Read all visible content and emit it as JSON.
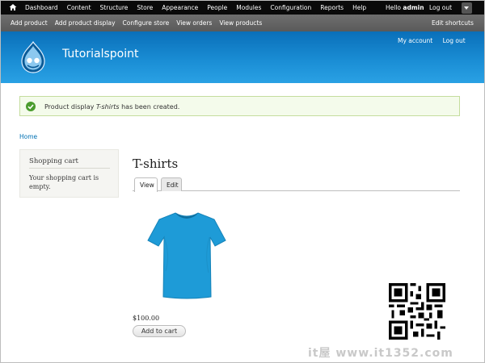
{
  "toolbar": {
    "menu": [
      "Dashboard",
      "Content",
      "Structure",
      "Store",
      "Appearance",
      "People",
      "Modules",
      "Configuration",
      "Reports",
      "Help"
    ],
    "hello_prefix": "Hello ",
    "username": "admin",
    "logout": "Log out",
    "home_icon": "home-icon",
    "toggle_icon": "chevron-down-icon"
  },
  "shortcuts": {
    "items": [
      "Add product",
      "Add product display",
      "Configure store",
      "View orders",
      "View products"
    ],
    "edit": "Edit shortcuts"
  },
  "header": {
    "site_name": "Tutorialspoint",
    "my_account": "My account",
    "log_out": "Log out",
    "logo_icon": "drupal-drop-logo"
  },
  "status": {
    "prefix": "Product display ",
    "item": "T-shirts",
    "suffix": " has been created.",
    "icon": "check-circle-icon",
    "accent": "#4b9c2e"
  },
  "breadcrumb": "Home",
  "sidebar": {
    "title": "Shopping cart",
    "body": "Your shopping cart is empty."
  },
  "main": {
    "title": "T-shirts",
    "tabs": [
      {
        "label": "View"
      },
      {
        "label": "Edit"
      }
    ],
    "price": "$100.00",
    "add_to_cart": "Add to cart",
    "product_color": "#1e9bd7"
  },
  "watermark": "it屋 www.it1352.com"
}
